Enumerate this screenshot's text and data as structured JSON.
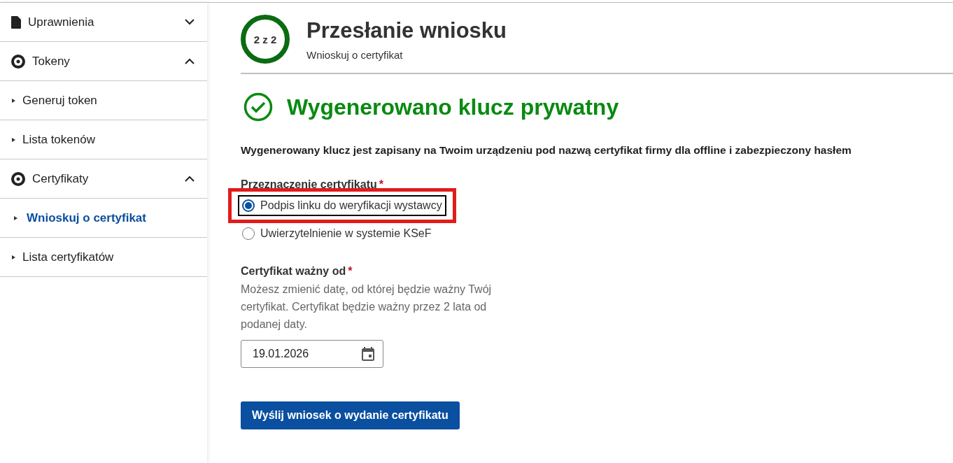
{
  "sidebar": {
    "items": [
      {
        "kind": "group",
        "label": "Uprawnienia",
        "expanded": false
      },
      {
        "kind": "group",
        "label": "Tokeny",
        "expanded": true
      },
      {
        "kind": "link",
        "label": "Generuj token",
        "selected": false
      },
      {
        "kind": "link",
        "label": "Lista tokenów",
        "selected": false
      },
      {
        "kind": "group",
        "label": "Certyfikaty",
        "expanded": true
      },
      {
        "kind": "link",
        "label": "Wnioskuj o certyfikat",
        "selected": true
      },
      {
        "kind": "link",
        "label": "Lista certyfikatów",
        "selected": false
      }
    ]
  },
  "header": {
    "step": "2 z 2",
    "title": "Przesłanie wniosku",
    "subtitle": "Wnioskuj o certyfikat"
  },
  "success": {
    "title": "Wygenerowano klucz prywatny",
    "message": "Wygenerowany klucz jest zapisany na Twoim urządzeniu pod nazwą certyfikat firmy dla offline i zabezpieczony hasłem"
  },
  "purpose": {
    "label": "Przeznaczenie certyfikatu",
    "required_mark": "*",
    "options": [
      {
        "label": "Podpis linku do weryfikacji wystawcy",
        "selected": true,
        "highlighted": true
      },
      {
        "label": "Uwierzytelnienie w systemie KSeF",
        "selected": false,
        "highlighted": false
      }
    ]
  },
  "valid_from": {
    "label": "Certyfikat ważny od",
    "required_mark": "*",
    "hint": "Możesz zmienić datę, od której będzie ważny Twój certyfikat. Certyfikat będzie ważny przez 2 lata od podanej daty.",
    "value": "19.01.2026"
  },
  "submit_button": "Wyślij wniosek o wydanie certyfikatu"
}
